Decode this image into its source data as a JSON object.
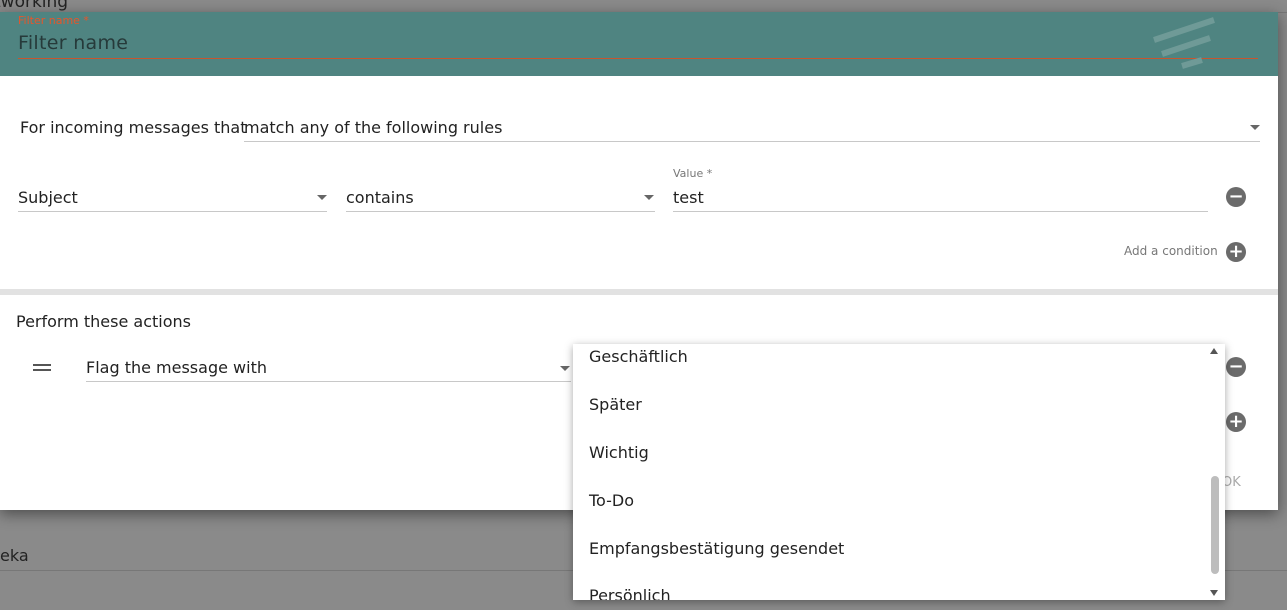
{
  "background": {
    "top_text": "tworking",
    "bottom_text": "eka"
  },
  "header": {
    "filter_name_label": "Filter name *",
    "filter_name_placeholder": "Filter name"
  },
  "rules": {
    "incoming_label": "For incoming messages that",
    "match_value": "match any of the following rules",
    "condition": {
      "field": "Subject",
      "operator": "contains",
      "value_label": "Value *",
      "value": "test"
    },
    "add_condition_label": "Add a condition"
  },
  "actions": {
    "heading": "Perform these actions",
    "action_value": "Flag the message with",
    "ok_label": "OK"
  },
  "flag_menu": {
    "items": [
      "Geschäftlich",
      "Später",
      "Wichtig",
      "To-Do",
      "Empfangsbestätigung gesendet",
      "Persönlich"
    ]
  },
  "icons": {
    "remove": "minus-circle-icon",
    "add": "plus-circle-icon",
    "drag": "drag-handle-icon",
    "dropdown": "chevron-down-icon"
  },
  "colors": {
    "header_bg": "#4f8481",
    "required_accent": "#e8552a",
    "icon_gray": "#6b6b6b"
  }
}
